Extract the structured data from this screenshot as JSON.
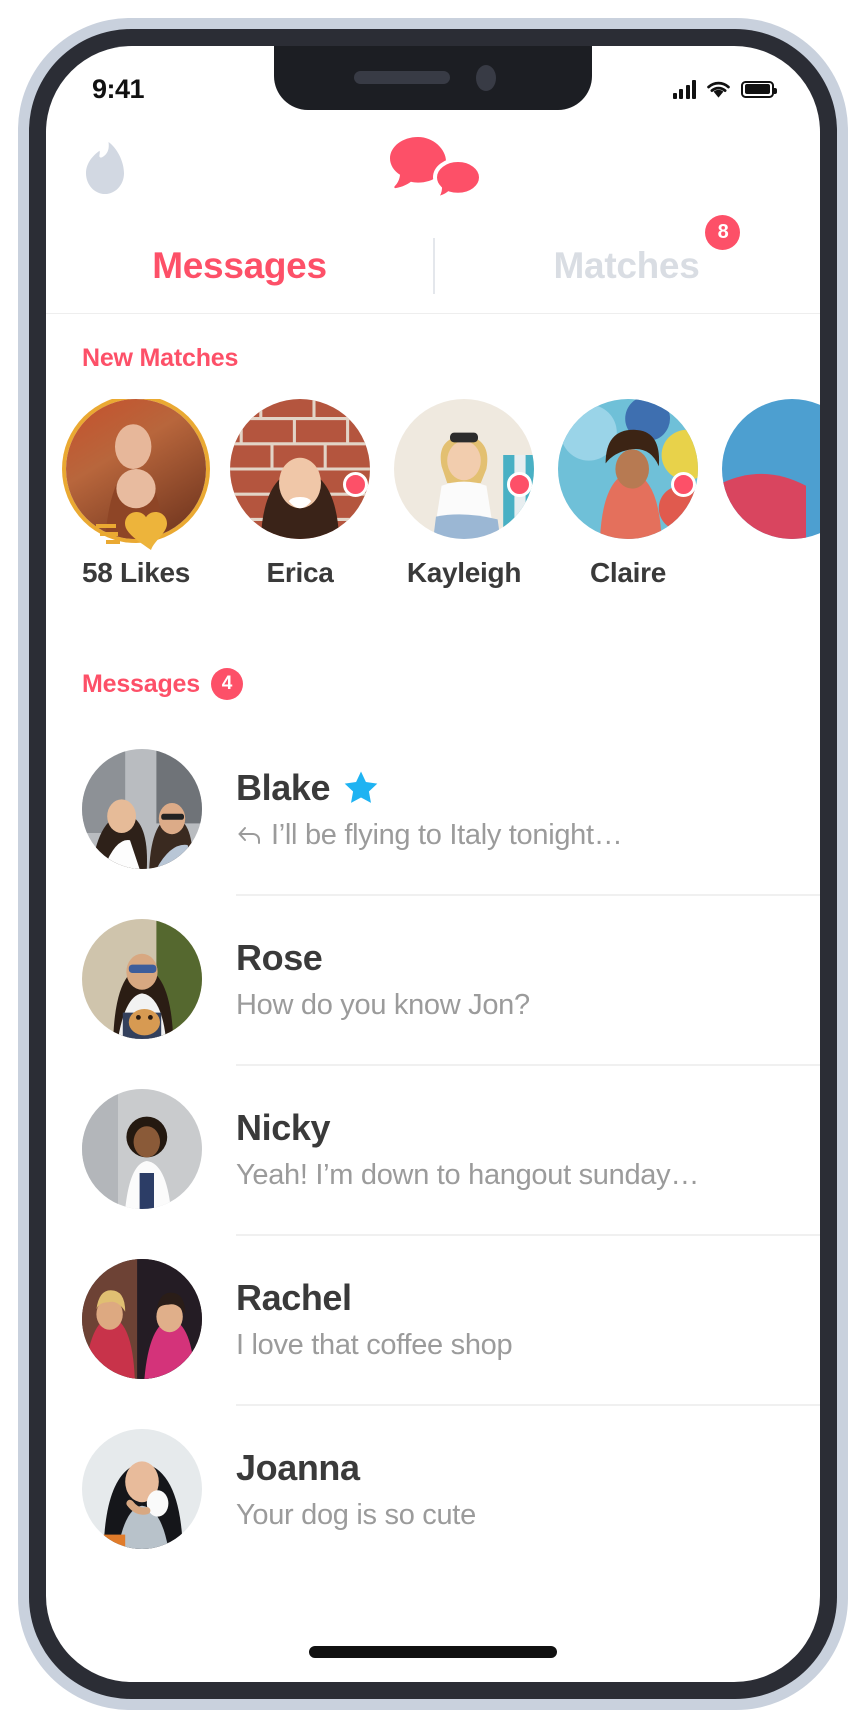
{
  "status_bar": {
    "time": "9:41",
    "signal_icon": "signal-bars-icon",
    "wifi_icon": "wifi-icon",
    "battery_icon": "battery-full-icon"
  },
  "header": {
    "brand_icon": "tinder-flame-icon",
    "title_icon": "chat-bubbles-icon",
    "accent_color": "#fd5068",
    "inactive_color": "#d9dde3"
  },
  "tabs": [
    {
      "label": "Messages",
      "active": true,
      "badge": ""
    },
    {
      "label": "Matches",
      "active": false,
      "badge": "8"
    }
  ],
  "new_matches": {
    "label": "New Matches",
    "items": [
      {
        "name": "58 Likes",
        "type": "likes",
        "ring": true,
        "dot": false,
        "icon": "gold-heart-icon"
      },
      {
        "name": "Erica",
        "type": "match",
        "ring": false,
        "dot": true
      },
      {
        "name": "Kayleigh",
        "type": "match",
        "ring": false,
        "dot": true
      },
      {
        "name": "Claire",
        "type": "match",
        "ring": false,
        "dot": true
      },
      {
        "name": "",
        "type": "match",
        "ring": false,
        "dot": false
      }
    ]
  },
  "messages": {
    "label": "Messages",
    "badge": "4",
    "rows": [
      {
        "name": "Blake",
        "preview": "I’ll be flying to Italy tonight…",
        "superlike": true,
        "replied": true
      },
      {
        "name": "Rose",
        "preview": "How do you know Jon?",
        "superlike": false,
        "replied": false
      },
      {
        "name": "Nicky",
        "preview": "Yeah! I’m down to hangout sunday…",
        "superlike": false,
        "replied": false
      },
      {
        "name": "Rachel",
        "preview": "I love that coffee shop",
        "superlike": false,
        "replied": false
      },
      {
        "name": "Joanna",
        "preview": "Your dog is so cute",
        "superlike": false,
        "replied": false
      }
    ]
  },
  "home_indicator": "home-indicator"
}
